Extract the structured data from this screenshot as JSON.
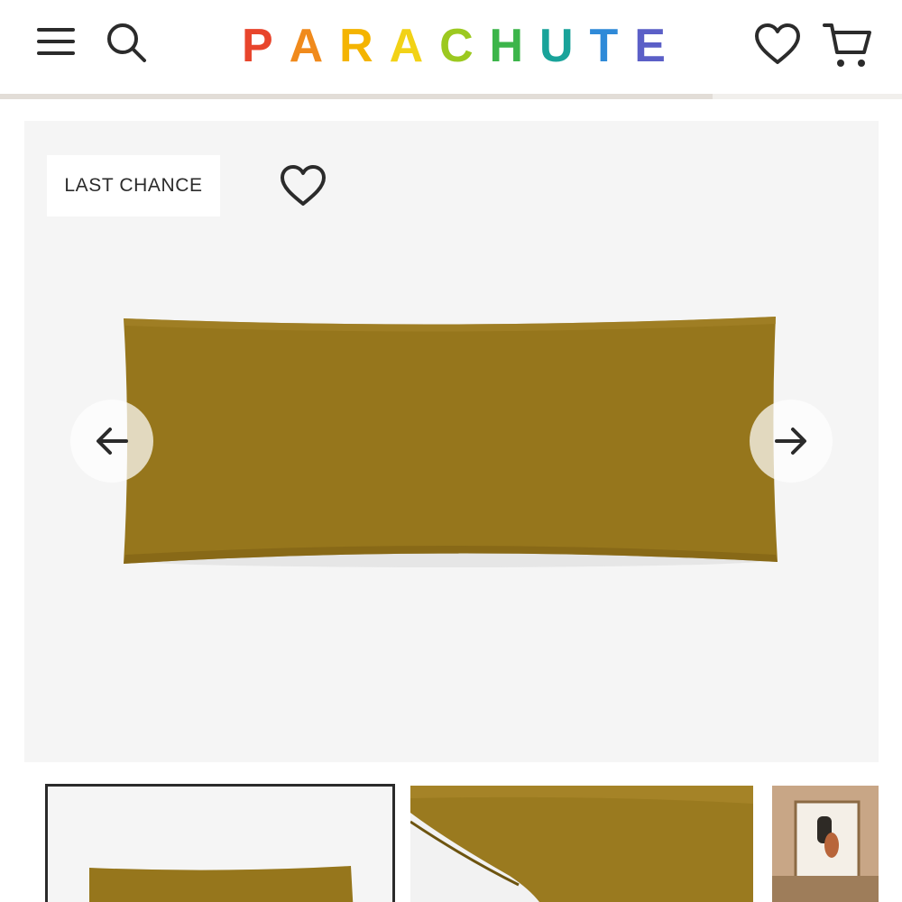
{
  "header": {
    "logo_letters": [
      {
        "ch": "P",
        "color": "#e8452c"
      },
      {
        "ch": "A",
        "color": "#f08a1c"
      },
      {
        "ch": "R",
        "color": "#f4b400"
      },
      {
        "ch": "A",
        "color": "#f2d216"
      },
      {
        "ch": "C",
        "color": "#9cc920"
      },
      {
        "ch": "H",
        "color": "#3cb54a"
      },
      {
        "ch": "U",
        "color": "#19a39a"
      },
      {
        "ch": "T",
        "color": "#2f8ad8"
      },
      {
        "ch": "E",
        "color": "#5b5fc7"
      }
    ],
    "icons": {
      "menu": "menu-icon",
      "search": "search-icon",
      "wishlist": "heart-icon",
      "cart": "cart-icon"
    }
  },
  "gallery_progress": 0.79,
  "product": {
    "badge": "LAST CHANCE",
    "pillow_color": "#96761c"
  },
  "colors": {
    "icon": "#2b2b2b",
    "hero_bg": "#f5f5f5"
  }
}
